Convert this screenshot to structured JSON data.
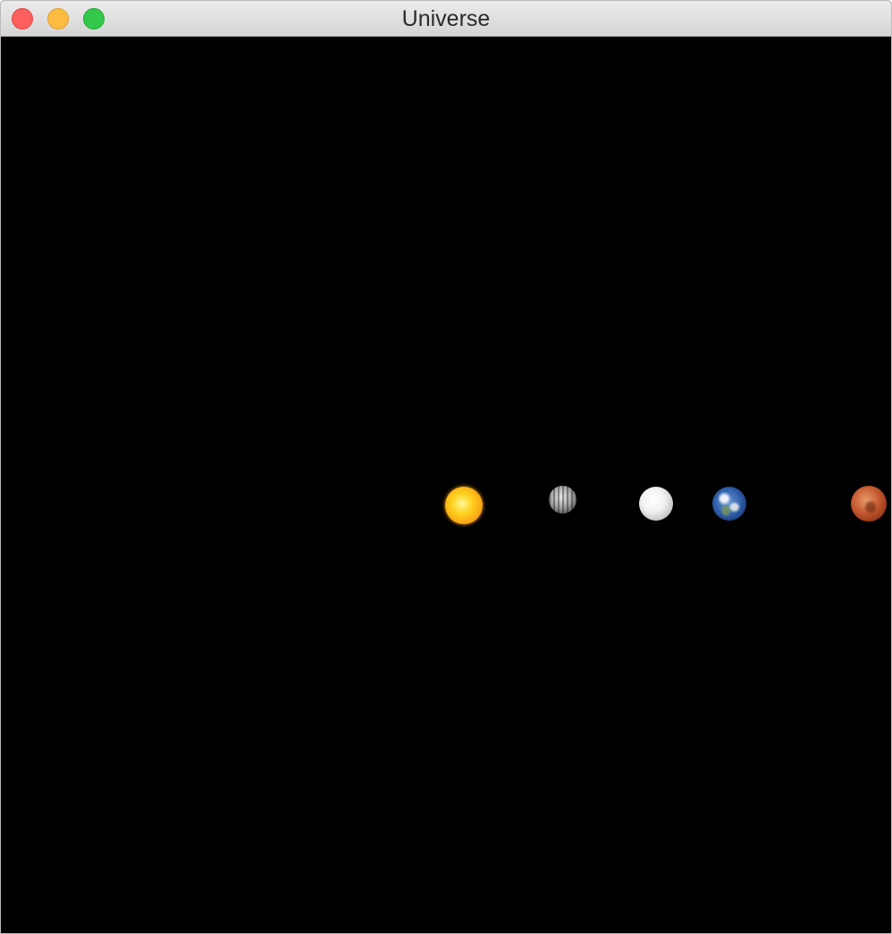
{
  "window": {
    "title": "Universe"
  },
  "titlebar": {
    "buttons": [
      {
        "name": "close-button",
        "color": "#fc605c"
      },
      {
        "name": "minimize-button",
        "color": "#fdbc40"
      },
      {
        "name": "zoom-button",
        "color": "#34c84a"
      }
    ]
  },
  "canvas": {
    "background": "#000000",
    "bodies": [
      {
        "name": "sun",
        "color": "#ffc21a"
      },
      {
        "name": "mercury",
        "color": "#9a9a9a"
      },
      {
        "name": "venus",
        "color": "#f0f0f0"
      },
      {
        "name": "earth",
        "color": "#2f5ea8"
      },
      {
        "name": "mars",
        "color": "#c5592f"
      }
    ]
  }
}
